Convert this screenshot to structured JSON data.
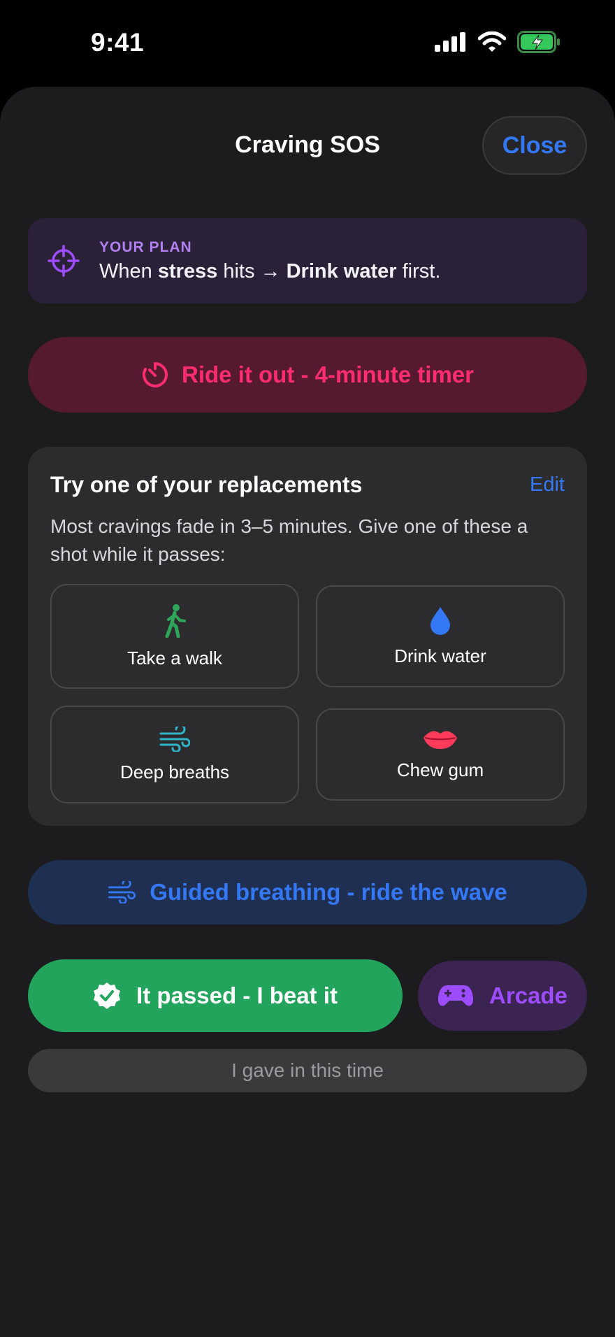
{
  "status_bar": {
    "time": "9:41"
  },
  "header": {
    "title": "Craving SOS",
    "close_label": "Close"
  },
  "plan": {
    "label": "YOUR PLAN",
    "prefix": "When ",
    "trigger": "stress",
    "middle": " hits → ",
    "action": "Drink water",
    "suffix": " first."
  },
  "timer": {
    "label": "Ride it out - 4-minute timer"
  },
  "replacements": {
    "title": "Try one of your replacements",
    "edit_label": "Edit",
    "description": "Most cravings fade in 3–5 minutes. Give one of these a shot while it passes:",
    "items": [
      {
        "label": "Take a walk",
        "icon": "walk-icon",
        "color": "#2fa55a"
      },
      {
        "label": "Drink water",
        "icon": "water-drop-icon",
        "color": "#3478f6"
      },
      {
        "label": "Deep breaths",
        "icon": "wind-icon",
        "color": "#2fb5c9"
      },
      {
        "label": "Chew gum",
        "icon": "lips-icon",
        "color": "#ff3b5c"
      }
    ]
  },
  "breathing": {
    "label": "Guided breathing - ride the wave"
  },
  "actions": {
    "beat_label": "It passed - I beat it",
    "arcade_label": "Arcade",
    "gave_in_label": "I gave in this time"
  },
  "colors": {
    "accent": "#3478f6",
    "timer": "#ff2d6f",
    "success": "#22a45d",
    "arcade": "#9d4dff",
    "plan": "#b380f2"
  }
}
